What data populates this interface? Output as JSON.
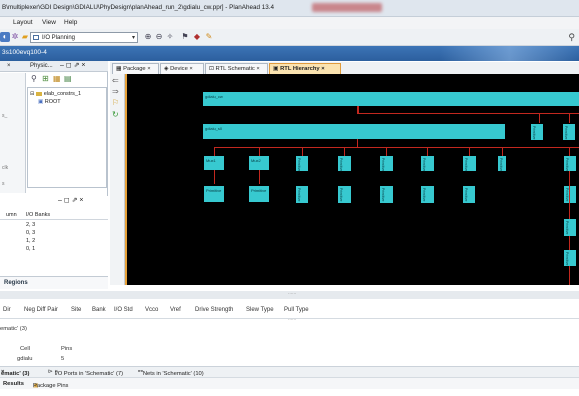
{
  "window": {
    "title": "B\\multiplexer\\GDI Design\\GDIALU\\PhyDesign\\planAhead_run_2\\gdialu_cw.ppr] - PlanAhead 13.4"
  },
  "menu": {
    "items": [
      "Layout",
      "View",
      "Help"
    ]
  },
  "toolbar": {
    "layout_value": "I/O Planning"
  },
  "project": {
    "part": "3s100evq100-4"
  },
  "left_panel": {
    "tab_label": "Physic...",
    "tree_items": [
      "elab_constrs_1",
      "ROOT"
    ],
    "strip_labels": [
      "s_",
      "clk",
      "s"
    ],
    "io_bank_columns": [
      "umn",
      "I/O Banks"
    ],
    "io_bank_rows": [
      "2, 3",
      "0, 3",
      "1, 2",
      "0, 1"
    ],
    "regions_label": "Regions"
  },
  "doc_tabs": [
    "Package",
    "Device",
    "RTL Schematic",
    "RTL Hierarchy"
  ],
  "rtl": {
    "top_node": "gdialu_cw",
    "mid_node": "gdialu_s0",
    "mux_nodes": [
      "Mux1",
      "Mux2"
    ],
    "leaf_labels": [
      "Primitive",
      "Primitive"
    ],
    "vertical_label": "Primitive"
  },
  "properties": {
    "columns": [
      "Dir",
      "Neg Diff Pair",
      "Site",
      "Bank",
      "I/O Std",
      "Vcco",
      "Vref",
      "Drive Strength",
      "Slew Type",
      "Pull Type"
    ]
  },
  "schematic": {
    "header": "ematic' (3)",
    "cell_columns": [
      "Cell",
      "Pins"
    ],
    "cell_row": [
      "gdialu",
      "5"
    ]
  },
  "bottom_tabs": [
    "ematic' (3)",
    "I/O Ports in 'Schematic' (7)",
    "Nets in 'Schematic' (10)"
  ],
  "results_tabs": [
    "Results",
    "Package Pins"
  ],
  "colors": {
    "canvas_bg": "#000000",
    "node": "#37c9d0",
    "wire": "#c3281f",
    "active_tab": "#fbe3b0"
  }
}
